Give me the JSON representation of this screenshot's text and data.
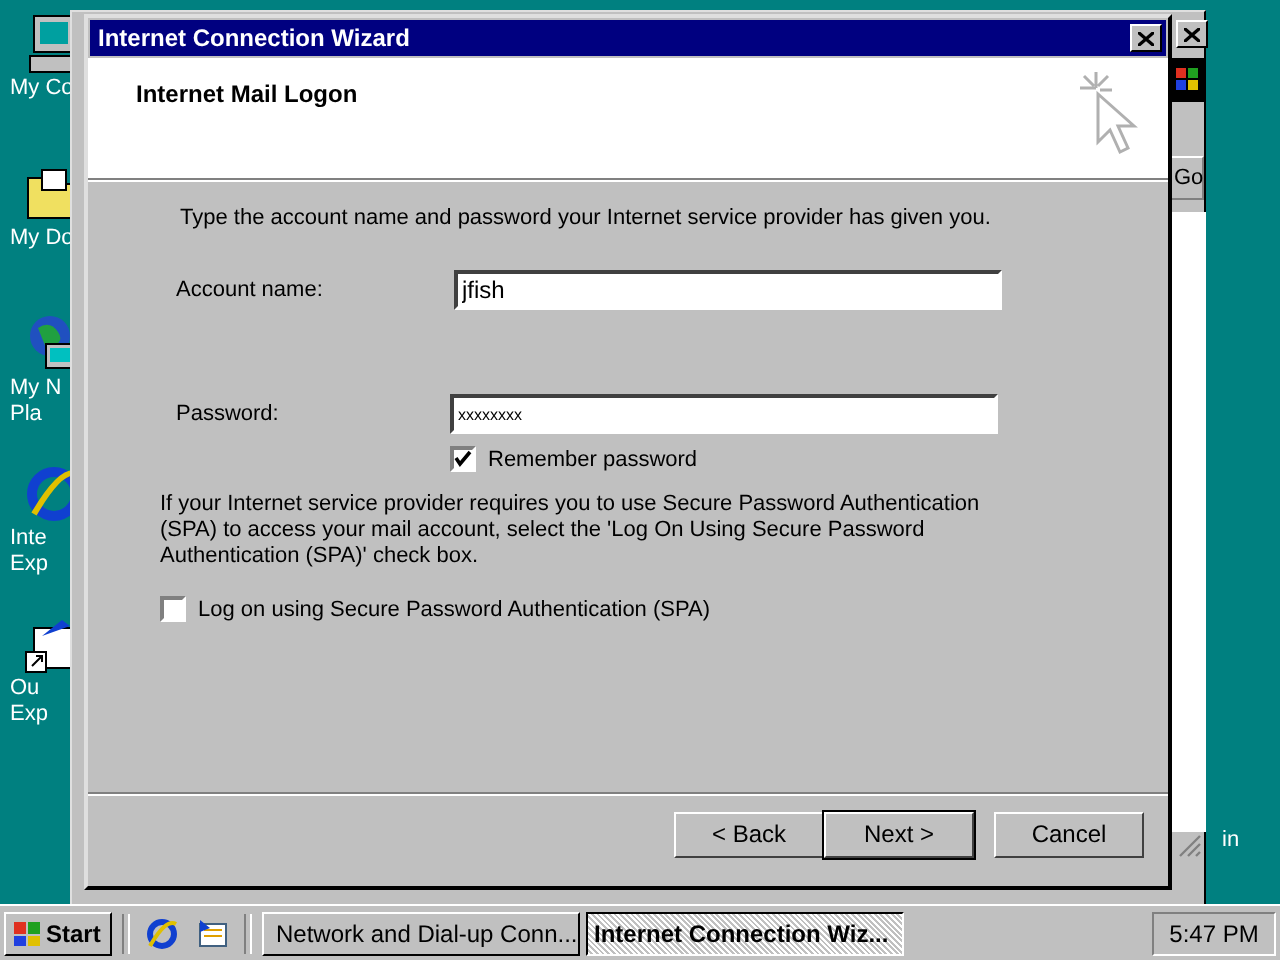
{
  "desktop_icons": [
    {
      "lines": [
        "My Co"
      ],
      "kind": "computer"
    },
    {
      "lines": [
        "My Do"
      ],
      "kind": "folder"
    },
    {
      "lines": [
        "My N",
        "Pla"
      ],
      "kind": "network"
    },
    {
      "lines": [
        "Inte",
        "Exp"
      ],
      "kind": "browser"
    },
    {
      "lines": [
        "Ou",
        "Exp"
      ],
      "kind": "mail"
    }
  ],
  "desktop_label_right": "in",
  "background_window": {
    "go_button": "Go"
  },
  "dialog": {
    "title": "Internet Connection Wizard",
    "header_title": "Internet Mail Logon",
    "intro": "Type the account name and password your Internet service provider has given you.",
    "account_label": "Account name:",
    "account_value": "jfish",
    "password_label": "Password:",
    "password_value": "xxxxxxxx",
    "remember": {
      "label": "Remember password",
      "checked": true
    },
    "spa_text": "If your Internet service provider requires you to use Secure Password Authentication (SPA) to access your mail account, select the 'Log On Using Secure Password Authentication (SPA)' check box.",
    "spa": {
      "label": "Log on using Secure Password Authentication (SPA)",
      "checked": false
    },
    "buttons": [
      {
        "label": "< Back",
        "default": false
      },
      {
        "label": "Next >",
        "default": true
      },
      {
        "label": "Cancel",
        "default": false
      }
    ]
  },
  "taskbar": {
    "start": "Start",
    "tasks": [
      {
        "label": "Network and Dial-up Conn...",
        "selected": false
      },
      {
        "label": "Internet Connection Wiz...",
        "selected": true
      }
    ],
    "clock": "5:47 PM"
  }
}
